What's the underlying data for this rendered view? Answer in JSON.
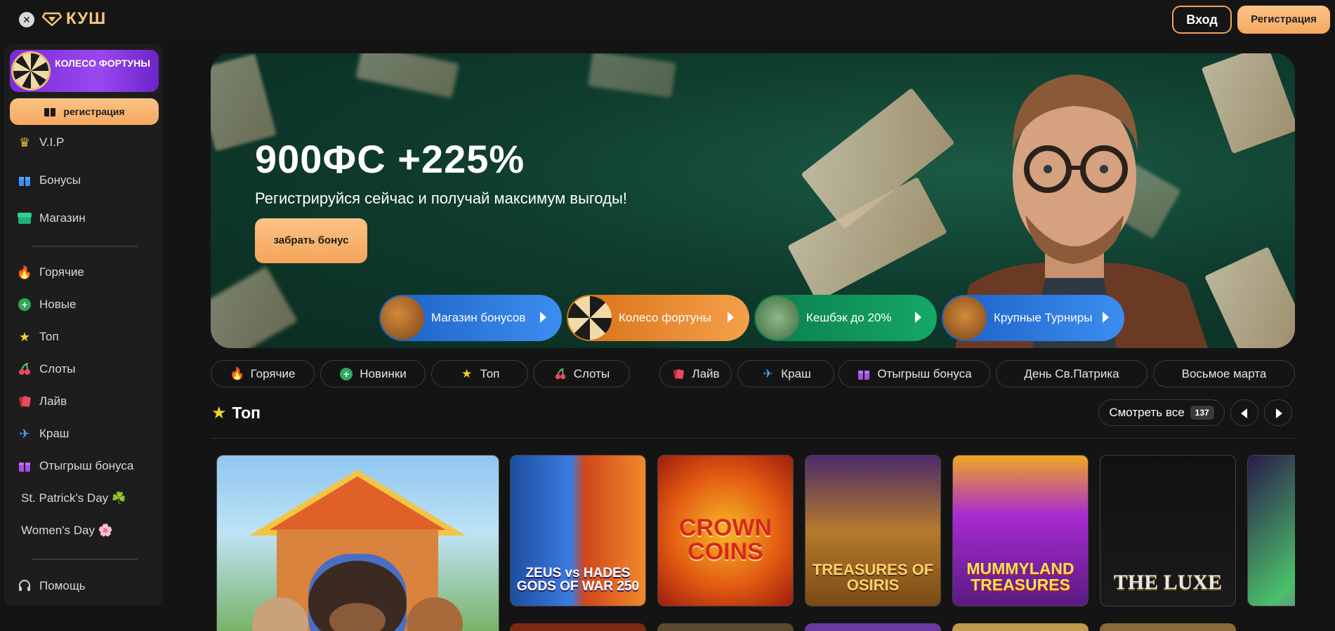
{
  "header": {
    "logo_text": "КУШ",
    "login_label": "Вход",
    "register_label": "Регистрация"
  },
  "sidebar": {
    "wheel_label": "КОЛЕСО ФОРТУНЫ",
    "register_label": "регистрация",
    "items": [
      {
        "label": "V.I.P",
        "icon": "crown-icon"
      },
      {
        "label": "Бонусы",
        "icon": "gift-icon"
      },
      {
        "label": "Магазин",
        "icon": "shop-icon"
      },
      {
        "label": "Горячие",
        "icon": "fire-icon"
      },
      {
        "label": "Новые",
        "icon": "plus-circle-icon"
      },
      {
        "label": "Топ",
        "icon": "star-icon"
      },
      {
        "label": "Слоты",
        "icon": "cherry-icon"
      },
      {
        "label": "Лайв",
        "icon": "cards-icon"
      },
      {
        "label": "Краш",
        "icon": "plane-icon"
      },
      {
        "label": "Отыгрыш бонуса",
        "icon": "gift-icon"
      },
      {
        "label": "St. Patrick's Day ☘️",
        "icon": ""
      },
      {
        "label": "Women's Day 🌸",
        "icon": ""
      },
      {
        "label": "Помощь",
        "icon": "headphones-icon"
      }
    ]
  },
  "hero": {
    "title": "900ФС +225%",
    "subtitle": "Регистрируйся сейчас и получай максимум выгоды!",
    "button_label": "забрать бонус",
    "promos": [
      {
        "label": "Магазин бонусов",
        "icon": "chest-icon",
        "color": "#2f7be0"
      },
      {
        "label": "Колесо фортуны",
        "icon": "wheel-icon",
        "color": "#f08d2f"
      },
      {
        "label": "Кешбэк до 20%",
        "icon": "cash-icon",
        "color": "#11a161"
      },
      {
        "label": "Крупные Турниры",
        "icon": "trophy-icon",
        "color": "#2f7be0"
      }
    ]
  },
  "categories": [
    {
      "label": "Горячие",
      "icon": "fire-icon"
    },
    {
      "label": "Новинки",
      "icon": "plus-circle-icon"
    },
    {
      "label": "Топ",
      "icon": "star-icon"
    },
    {
      "label": "Слоты",
      "icon": "cherry-icon"
    },
    {
      "label": "Лайв",
      "icon": "cards-icon"
    },
    {
      "label": "Краш",
      "icon": "plane-icon"
    },
    {
      "label": "Отыгрыш бонуса",
      "icon": "gift-icon"
    },
    {
      "label": "День Св.Патрика",
      "icon": ""
    },
    {
      "label": "Восьмое марта",
      "icon": ""
    }
  ],
  "top_section": {
    "title": "Топ",
    "see_all_label": "Смотреть все",
    "count": "137",
    "games": [
      {
        "title": "",
        "name": "dog-house"
      },
      {
        "title": "ZEUS vs HADES GODS OF WAR 250",
        "name": "zeus-vs-hades"
      },
      {
        "title": "CROWN COINS",
        "name": "crown-coins"
      },
      {
        "title": "TREASURES OF OSIRIS",
        "name": "treasures-of-osiris"
      },
      {
        "title": "MUMMYLAND TREASURES",
        "name": "mummyland-treasures"
      },
      {
        "title": "THE LUXE",
        "name": "the-luxe"
      }
    ]
  },
  "colors": {
    "accent": "#f6a860",
    "background": "#141414",
    "panel": "#1d1d1d"
  }
}
